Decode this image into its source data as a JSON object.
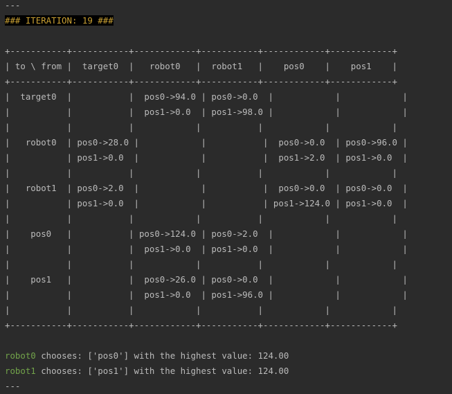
{
  "header": {
    "separator_top": "---",
    "iteration_banner": "### ITERATION: 19 ###"
  },
  "table": {
    "border": "+-----------+-----------+------------+-----------+------------+------------+",
    "rows": [
      "| to \\ from |  target0  |   robot0   |  robot1   |    pos0    |    pos1    |",
      "|  target0  |           |  pos0->94.0 | pos0->0.0  |            |            |",
      "|           |           |  pos1->0.0  | pos1->98.0 |            |            |",
      "|           |           |            |           |            |            |",
      "|   robot0  | pos0->28.0 |            |           |  pos0->0.0  | pos0->96.0 |",
      "|           | pos1->0.0  |            |           |  pos1->2.0  | pos1->0.0  |",
      "|           |           |            |           |            |            |",
      "|   robot1  | pos0->2.0  |            |           |  pos0->0.0  | pos0->0.0  |",
      "|           | pos1->0.0  |            |           | pos1->124.0 | pos1->0.0  |",
      "|           |           |            |           |            |            |",
      "|    pos0   |           | pos0->124.0 | pos0->2.0  |            |            |",
      "|           |           |  pos1->0.0  | pos1->0.0  |            |            |",
      "|           |           |            |           |            |            |",
      "|    pos1   |           |  pos0->26.0 | pos0->0.0  |            |            |",
      "|           |           |  pos1->0.0  | pos1->96.0 |            |            |",
      "|           |           |            |           |            |            |"
    ]
  },
  "results": [
    {
      "robot": "robot0",
      "text": " chooses: ['pos0'] with the highest value: 124.00"
    },
    {
      "robot": "robot1",
      "text": " chooses: ['pos1'] with the highest value: 124.00"
    }
  ],
  "footer": {
    "separator_bottom": "---"
  },
  "colors": {
    "background": "#2b2b2b",
    "text": "#bbbbbb",
    "banner_bg": "#000000",
    "banner_fg": "#c9a033",
    "robot_name": "#72a34a"
  }
}
